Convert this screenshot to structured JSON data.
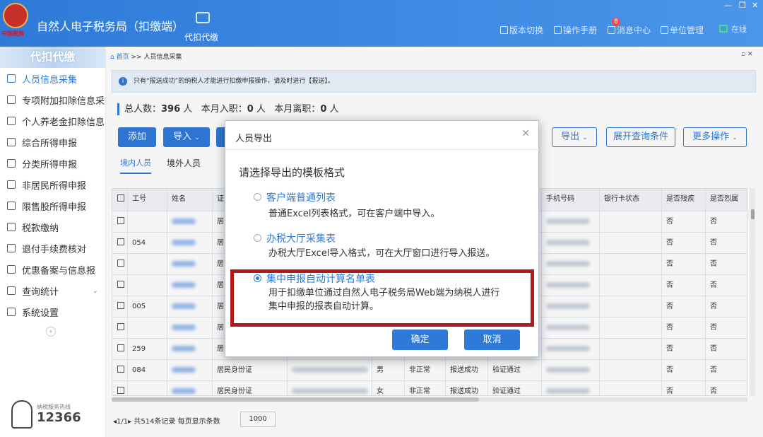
{
  "header": {
    "logo_text": "中国税务",
    "title": "自然人电子税务局（扣缴端）",
    "nav_tab": "代扣代缴",
    "links": [
      "版本切换",
      "操作手册",
      "消息中心",
      "单位管理"
    ],
    "badge": "8",
    "online": "在线"
  },
  "sidebar": {
    "title": "代扣代缴",
    "items": [
      "人员信息采集",
      "专项附加扣除信息采集",
      "个人养老金扣除信息",
      "综合所得申报",
      "分类所得申报",
      "非居民所得申报",
      "限售股所得申报",
      "税款缴纳",
      "退付手续费核对",
      "优惠备案与信息报",
      "查询统计",
      "系统设置"
    ],
    "hotline_label": "纳税服务热线",
    "hotline": "12366"
  },
  "breadcrumb": {
    "home": "首页",
    "sep": ">>",
    "current": "人员信息采集"
  },
  "notice": "只有“报送成功”的纳税人才能进行扣缴申报操作，请及时进行【报送】。",
  "stats": {
    "total_label": "总人数：",
    "total": "396",
    "total_unit": "人",
    "hired_label": "本月入职：",
    "hired": "0",
    "hired_unit": "人",
    "left_label": "本月离职：",
    "left": "0",
    "left_unit": "人"
  },
  "toolbar": {
    "add": "添加",
    "import": "导入",
    "export": "导出",
    "expand": "展开查询条件",
    "more": "更多操作"
  },
  "tabs": [
    "境内人员",
    "境外人员"
  ],
  "table": {
    "headers": [
      "",
      "工号",
      "姓名",
      "证",
      "",
      "",
      "",
      "",
      "",
      "手机号码",
      "银行卡状态",
      "是否残疾",
      "是否烈属"
    ],
    "rows": [
      {
        "id": "",
        "idtype": "居",
        "no": "否",
        "no2": "否"
      },
      {
        "id": "054",
        "idtype": "居",
        "no": "否",
        "no2": "否"
      },
      {
        "id": "",
        "idtype": "居",
        "no": "否",
        "no2": "否"
      },
      {
        "id": "",
        "idtype": "居",
        "no": "否",
        "no2": "否"
      },
      {
        "id": "005",
        "idtype": "居",
        "no": "否",
        "no2": "否"
      },
      {
        "id": "",
        "idtype": "居",
        "no": "否",
        "no2": "否"
      },
      {
        "id": "259",
        "idtype": "居",
        "no": "否",
        "no2": "否"
      },
      {
        "id": "084",
        "idtype": "居民身份证",
        "sex": "男",
        "status": "非正常",
        "report": "报送成功",
        "verify": "验证通过",
        "no": "否",
        "no2": "否"
      },
      {
        "id": "",
        "idtype": "居民身份证",
        "sex": "女",
        "status": "非正常",
        "report": "报送成功",
        "verify": "验证通过",
        "no": "否",
        "no2": "否"
      }
    ]
  },
  "pager": {
    "text": "1/1",
    "records": "共514条记录",
    "per_label": "每页显示条数",
    "per": "1000"
  },
  "modal": {
    "title": "人员导出",
    "prompt": "请选择导出的模板格式",
    "options": [
      {
        "title": "客户端普通列表",
        "desc": "普通Excel列表格式，可在客户端中导入。"
      },
      {
        "title": "办税大厅采集表",
        "desc": "办税大厅Excel导入格式，可在大厅窗口进行导入报送。"
      },
      {
        "title": "集中申报自动计算名单表",
        "desc1": "用于扣缴单位通过自然人电子税务局Web端为纳税人进行",
        "desc2": "集中申报的报表自动计算。"
      }
    ],
    "confirm": "确定",
    "cancel": "取消"
  },
  "colors": {
    "primary": "#2f7ad9",
    "highlight": "#b01a1a"
  }
}
